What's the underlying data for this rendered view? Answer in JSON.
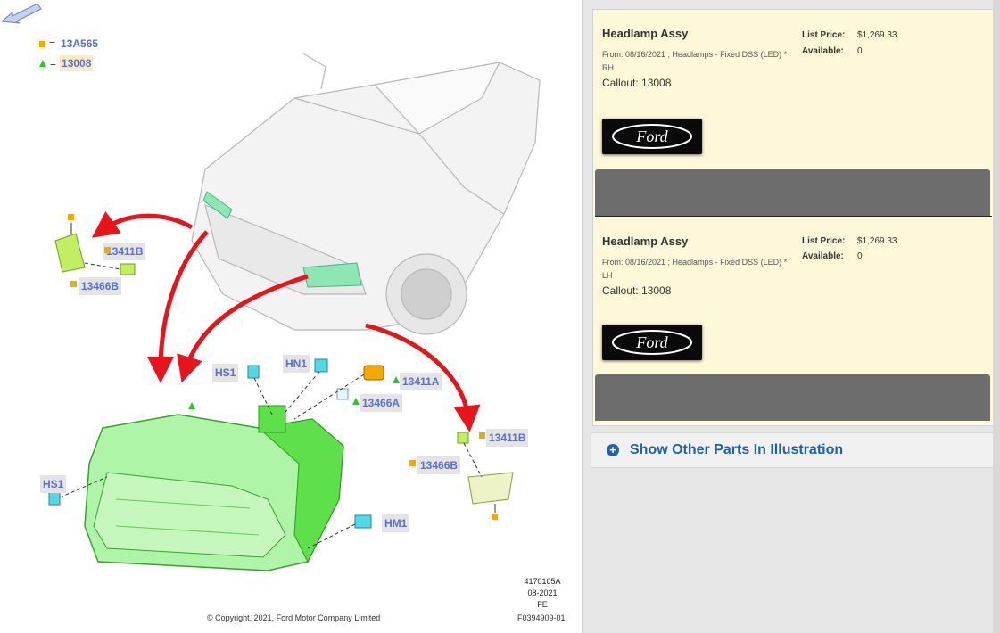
{
  "legend": [
    {
      "marker": "square",
      "code": "13A565",
      "highlighted": false
    },
    {
      "marker": "triangle",
      "code": "13008",
      "highlighted": true
    }
  ],
  "legend_eq": "=",
  "callouts": {
    "left_side_a": "13411B",
    "left_side_b": "13466B",
    "hs1_top": "HS1",
    "hn1": "HN1",
    "right_13411a": "13411A",
    "right_13466a": "13466A",
    "right_13411b": "13411B",
    "right_13466b": "13466B",
    "hs1_left": "HS1",
    "hm1": "HM1"
  },
  "figure": {
    "number": "4170105A",
    "date": "08-2021",
    "code": "FE",
    "id": "F0394909-01",
    "copyright": "© Copyright, 2021, Ford Motor Company Limited"
  },
  "parts": [
    {
      "title": "Headlamp Assy",
      "description": "From: 08/16/2021 ; Headlamps - Fixed DSS (LED) * RH",
      "callout": "Callout: 13008",
      "list_price_label": "List Price:",
      "list_price": "$1,269.33",
      "available_label": "Available:",
      "available": "0",
      "brand": "Ford"
    },
    {
      "title": "Headlamp Assy",
      "description": "From: 08/16/2021 ; Headlamps - Fixed DSS (LED) * LH",
      "callout": "Callout: 13008",
      "list_price_label": "List Price:",
      "list_price": "$1,269.33",
      "available_label": "Available:",
      "available": "0",
      "brand": "Ford"
    }
  ],
  "show_other_label": "Show Other Parts In Illustration",
  "colors": {
    "callout_text": "#5a6fd6",
    "highlight_green": "#66ee44",
    "arrow_red": "#e8141c",
    "card_bg": "#fdf8d8",
    "link_blue": "#1f62a8"
  }
}
